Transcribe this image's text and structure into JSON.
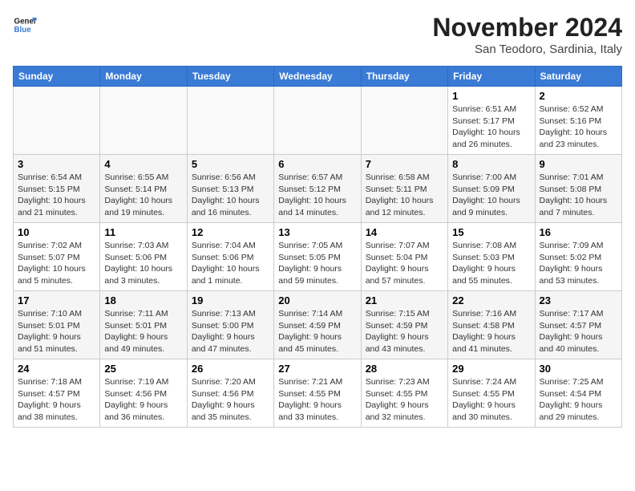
{
  "logo": {
    "line1": "General",
    "line2": "Blue"
  },
  "title": "November 2024",
  "location": "San Teodoro, Sardinia, Italy",
  "weekdays": [
    "Sunday",
    "Monday",
    "Tuesday",
    "Wednesday",
    "Thursday",
    "Friday",
    "Saturday"
  ],
  "weeks": [
    [
      {
        "day": "",
        "info": ""
      },
      {
        "day": "",
        "info": ""
      },
      {
        "day": "",
        "info": ""
      },
      {
        "day": "",
        "info": ""
      },
      {
        "day": "",
        "info": ""
      },
      {
        "day": "1",
        "info": "Sunrise: 6:51 AM\nSunset: 5:17 PM\nDaylight: 10 hours and 26 minutes."
      },
      {
        "day": "2",
        "info": "Sunrise: 6:52 AM\nSunset: 5:16 PM\nDaylight: 10 hours and 23 minutes."
      }
    ],
    [
      {
        "day": "3",
        "info": "Sunrise: 6:54 AM\nSunset: 5:15 PM\nDaylight: 10 hours and 21 minutes."
      },
      {
        "day": "4",
        "info": "Sunrise: 6:55 AM\nSunset: 5:14 PM\nDaylight: 10 hours and 19 minutes."
      },
      {
        "day": "5",
        "info": "Sunrise: 6:56 AM\nSunset: 5:13 PM\nDaylight: 10 hours and 16 minutes."
      },
      {
        "day": "6",
        "info": "Sunrise: 6:57 AM\nSunset: 5:12 PM\nDaylight: 10 hours and 14 minutes."
      },
      {
        "day": "7",
        "info": "Sunrise: 6:58 AM\nSunset: 5:11 PM\nDaylight: 10 hours and 12 minutes."
      },
      {
        "day": "8",
        "info": "Sunrise: 7:00 AM\nSunset: 5:09 PM\nDaylight: 10 hours and 9 minutes."
      },
      {
        "day": "9",
        "info": "Sunrise: 7:01 AM\nSunset: 5:08 PM\nDaylight: 10 hours and 7 minutes."
      }
    ],
    [
      {
        "day": "10",
        "info": "Sunrise: 7:02 AM\nSunset: 5:07 PM\nDaylight: 10 hours and 5 minutes."
      },
      {
        "day": "11",
        "info": "Sunrise: 7:03 AM\nSunset: 5:06 PM\nDaylight: 10 hours and 3 minutes."
      },
      {
        "day": "12",
        "info": "Sunrise: 7:04 AM\nSunset: 5:06 PM\nDaylight: 10 hours and 1 minute."
      },
      {
        "day": "13",
        "info": "Sunrise: 7:05 AM\nSunset: 5:05 PM\nDaylight: 9 hours and 59 minutes."
      },
      {
        "day": "14",
        "info": "Sunrise: 7:07 AM\nSunset: 5:04 PM\nDaylight: 9 hours and 57 minutes."
      },
      {
        "day": "15",
        "info": "Sunrise: 7:08 AM\nSunset: 5:03 PM\nDaylight: 9 hours and 55 minutes."
      },
      {
        "day": "16",
        "info": "Sunrise: 7:09 AM\nSunset: 5:02 PM\nDaylight: 9 hours and 53 minutes."
      }
    ],
    [
      {
        "day": "17",
        "info": "Sunrise: 7:10 AM\nSunset: 5:01 PM\nDaylight: 9 hours and 51 minutes."
      },
      {
        "day": "18",
        "info": "Sunrise: 7:11 AM\nSunset: 5:01 PM\nDaylight: 9 hours and 49 minutes."
      },
      {
        "day": "19",
        "info": "Sunrise: 7:13 AM\nSunset: 5:00 PM\nDaylight: 9 hours and 47 minutes."
      },
      {
        "day": "20",
        "info": "Sunrise: 7:14 AM\nSunset: 4:59 PM\nDaylight: 9 hours and 45 minutes."
      },
      {
        "day": "21",
        "info": "Sunrise: 7:15 AM\nSunset: 4:59 PM\nDaylight: 9 hours and 43 minutes."
      },
      {
        "day": "22",
        "info": "Sunrise: 7:16 AM\nSunset: 4:58 PM\nDaylight: 9 hours and 41 minutes."
      },
      {
        "day": "23",
        "info": "Sunrise: 7:17 AM\nSunset: 4:57 PM\nDaylight: 9 hours and 40 minutes."
      }
    ],
    [
      {
        "day": "24",
        "info": "Sunrise: 7:18 AM\nSunset: 4:57 PM\nDaylight: 9 hours and 38 minutes."
      },
      {
        "day": "25",
        "info": "Sunrise: 7:19 AM\nSunset: 4:56 PM\nDaylight: 9 hours and 36 minutes."
      },
      {
        "day": "26",
        "info": "Sunrise: 7:20 AM\nSunset: 4:56 PM\nDaylight: 9 hours and 35 minutes."
      },
      {
        "day": "27",
        "info": "Sunrise: 7:21 AM\nSunset: 4:55 PM\nDaylight: 9 hours and 33 minutes."
      },
      {
        "day": "28",
        "info": "Sunrise: 7:23 AM\nSunset: 4:55 PM\nDaylight: 9 hours and 32 minutes."
      },
      {
        "day": "29",
        "info": "Sunrise: 7:24 AM\nSunset: 4:55 PM\nDaylight: 9 hours and 30 minutes."
      },
      {
        "day": "30",
        "info": "Sunrise: 7:25 AM\nSunset: 4:54 PM\nDaylight: 9 hours and 29 minutes."
      }
    ]
  ]
}
